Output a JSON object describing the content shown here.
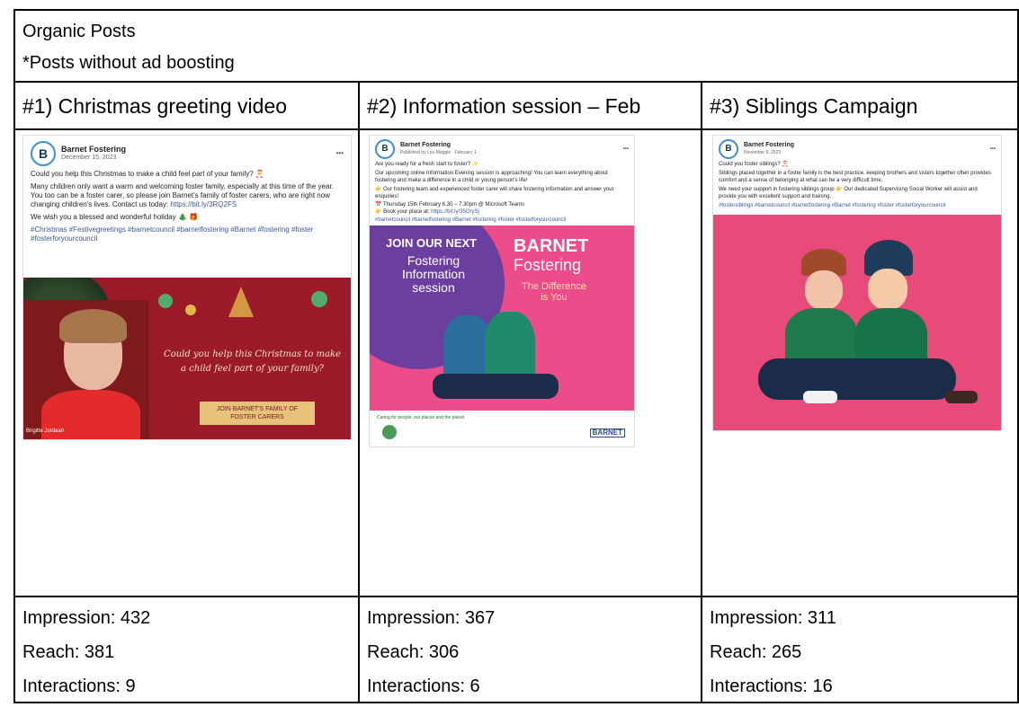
{
  "header": {
    "title": "Organic Posts",
    "subtitle": "*Posts without ad boosting"
  },
  "columns": [
    {
      "heading": "#1) Christmas greeting video",
      "post": {
        "page_name": "Barnet Fostering",
        "date": "December 15, 2023 · ",
        "text1": "Could you help this Christmas to make a child feel part of your family? 🎅",
        "text2": "Many children only want a warm and welcoming foster family, especially at this time of the year. You too can be a foster carer, so please join Barnet's family of foster carers, who are right now changing children's lives. Contact us today: ",
        "link": "https://bit.ly/3RQ2FS",
        "text3": "We wish you a blessed and wonderful holiday 🎄 🎁",
        "hashtags": "#Christmas #Festivegreetings #barnetcouncil #barnetfostering #Barnet #fostering #foster #fosterforyourcouncil",
        "image_script": "Could you help this Christmas to make a child feel part of your family?",
        "image_banner": "JOIN BARNET'S FAMILY OF FOSTER CARERS",
        "speaker": "Brigitte Jordaan"
      },
      "stats": {
        "impression": "Impression: 432",
        "reach": "Reach: 381",
        "interactions": "Interactions: 9"
      }
    },
    {
      "heading": "#2) Information session – Feb",
      "post": {
        "page_name": "Barnet Fostering",
        "date": "Published by Lou Maggie · February 1 · ",
        "text1": "Are you ready for a fresh start to foster? ✨",
        "text2": "Our upcoming online Information Evening session is approaching! You can learn everything about fostering and make a difference in a child or young person's life!",
        "text3": "👉 Our fostering team and experienced foster carer will share fostering information and answer your enquiries!",
        "text4": "📅 Thursday 15th February 6.30 – 7.30pm @ Microsoft Teams",
        "text5": "👉 Book your place at: ",
        "link": "https://bit.ly/35OrySj",
        "hashtags": "#barnetcouncil #barnetfostering #Barnet #fostering #foster #fosterforyourcouncil",
        "poster_join": "JOIN OUR NEXT",
        "poster_title": "Fostering Information session",
        "poster_brand1": "BARNET",
        "poster_brand2": "Fostering",
        "poster_tagline": "The Difference is You",
        "footer_text": "Caring for people, our places and the planet",
        "footer_logo": "BARNET"
      },
      "stats": {
        "impression": "Impression: 367",
        "reach": "Reach: 306",
        "interactions": "Interactions: 6"
      }
    },
    {
      "heading": "#3) Siblings Campaign",
      "post": {
        "page_name": "Barnet Fostering",
        "date": "November 6, 2023 · ",
        "text1": "Could you foster siblings? 🎅",
        "text2": "Siblings placed together in a foster family is the best practice, keeping brothers and sisters together often provides comfort and a sense of belonging at what can be a very difficult time.",
        "text3": "We need your support in fostering siblings group 👉 Our dedicated Supervising Social Worker will assist and provide you with excellent support and training.",
        "hashtags": "#fostersiblings #barnetcouncil #barnetfostering #Barnet #fostering #foster #fosterforyourcouncil"
      },
      "stats": {
        "impression": "Impression: 311",
        "reach": "Reach: 265",
        "interactions": "Interactions: 16"
      }
    }
  ],
  "colors": {
    "link": "#385898",
    "xmas_red": "#9c1b2a",
    "poster_purple": "#6b3fa0",
    "poster_pink": "#ec4c8a",
    "sibling_pink": "#e84a79"
  }
}
